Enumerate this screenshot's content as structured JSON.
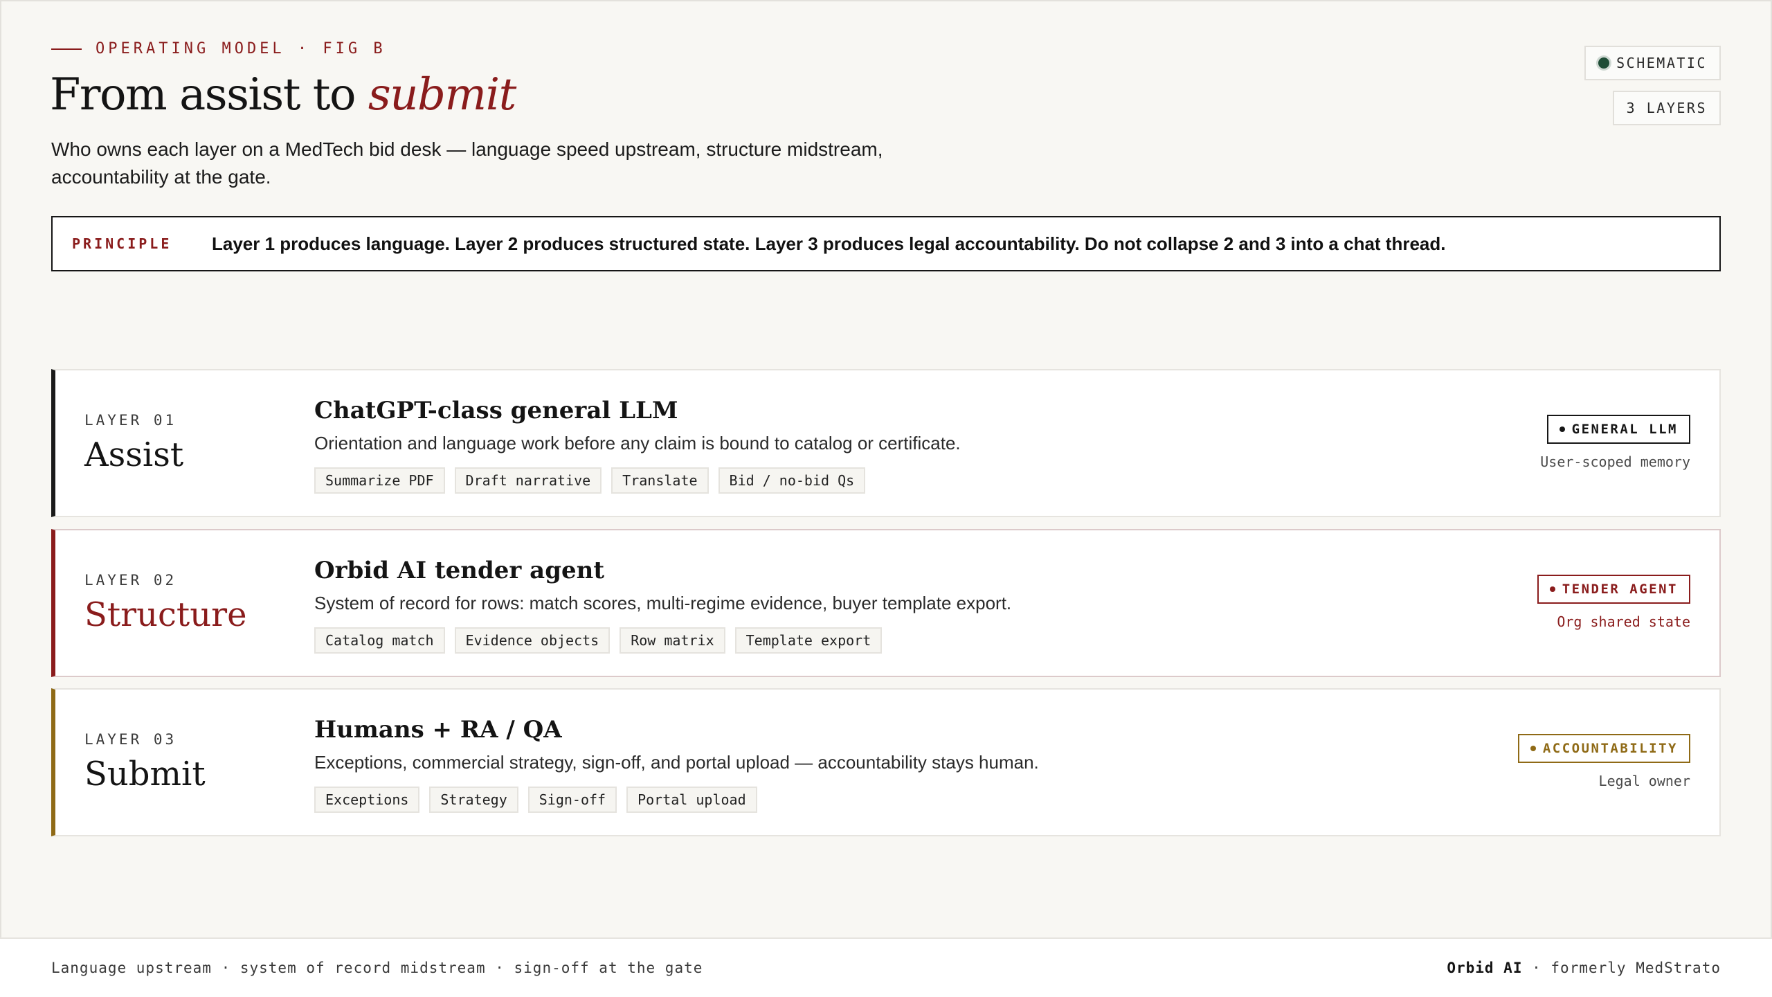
{
  "header": {
    "eyebrow": "OPERATING MODEL · FIG B",
    "title_main": "From assist to ",
    "title_emph": "submit",
    "subtitle": "Who owns each layer on a MedTech bid desk — language speed upstream, structure midstream, accountability at the gate.",
    "badges": [
      "SCHEMATIC",
      "3 LAYERS"
    ]
  },
  "principle": {
    "label": "PRINCIPLE",
    "text": "Layer 1 produces language. Layer 2 produces structured state. Layer 3 produces legal accountability. Do not collapse 2 and 3 into a chat thread."
  },
  "layers": [
    {
      "number": "LAYER 01",
      "name": "Assist",
      "heading": "ChatGPT-class general LLM",
      "description": "Orientation and language work before any claim is bound to catalog or certificate.",
      "chips": [
        "Summarize PDF",
        "Draft narrative",
        "Translate",
        "Bid / no-bid Qs"
      ],
      "role": "GENERAL LLM",
      "scope": "User-scoped memory"
    },
    {
      "number": "LAYER 02",
      "name": "Structure",
      "heading": "Orbid AI tender agent",
      "description": "System of record for rows: match scores, multi-regime evidence, buyer template export.",
      "chips": [
        "Catalog match",
        "Evidence objects",
        "Row matrix",
        "Template export"
      ],
      "role": "TENDER AGENT",
      "scope": "Org shared state"
    },
    {
      "number": "LAYER 03",
      "name": "Submit",
      "heading": "Humans + RA / QA",
      "description": "Exceptions, commercial strategy, sign-off, and portal upload — accountability stays human.",
      "chips": [
        "Exceptions",
        "Strategy",
        "Sign-off",
        "Portal upload"
      ],
      "role": "ACCOUNTABILITY",
      "scope": "Legal owner"
    }
  ],
  "footer": {
    "left": "Language upstream · system of record midstream · sign-off at the gate",
    "brand": "Orbid AI",
    "right_rest": " · formerly MedStrato"
  },
  "colors": {
    "accent_red": "#8a1c1c",
    "accent_gold": "#8f6a16",
    "ink": "#161616",
    "schematic_dot": "#1f4d36"
  }
}
